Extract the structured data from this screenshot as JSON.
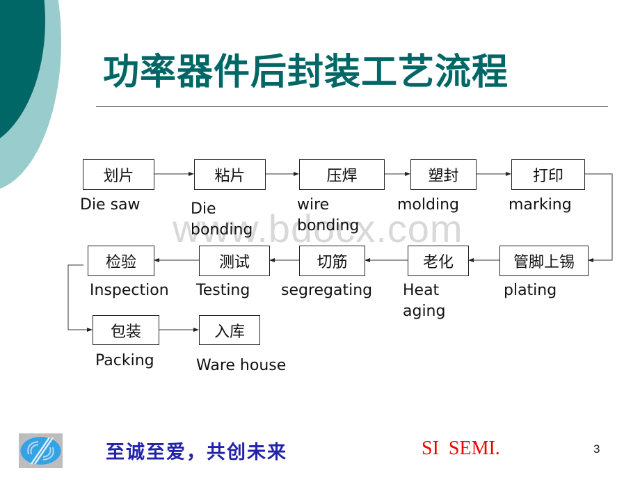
{
  "slide": {
    "title": "功率器件后封装工艺流程",
    "watermark": "www.bdocx.com",
    "page_number": "3"
  },
  "colors": {
    "title": "#006666",
    "deco_dark": "#006666",
    "deco_light": "#99cccc",
    "slogan": "#2222aa",
    "brand": "#ee0000",
    "logo_blue": "#33a3e6"
  },
  "flow": {
    "steps": [
      {
        "zh": "划片",
        "en_lines": [
          "Die saw"
        ]
      },
      {
        "zh": "粘片",
        "en_lines": [
          "Die",
          "bonding"
        ]
      },
      {
        "zh": "压焊",
        "en_lines": [
          "wire",
          "bonding"
        ]
      },
      {
        "zh": "塑封",
        "en_lines": [
          "molding"
        ]
      },
      {
        "zh": "打印",
        "en_lines": [
          "marking"
        ]
      },
      {
        "zh": "管脚上锡",
        "en_lines": [
          "plating"
        ]
      },
      {
        "zh": "老化",
        "en_lines": [
          "Heat",
          "aging"
        ]
      },
      {
        "zh": "切筋",
        "en_lines": [
          "segregating"
        ]
      },
      {
        "zh": "测试",
        "en_lines": [
          "Testing"
        ]
      },
      {
        "zh": "检验",
        "en_lines": [
          "Inspection"
        ]
      },
      {
        "zh": "包装",
        "en_lines": [
          "Packing"
        ]
      },
      {
        "zh": "入库",
        "en_lines": [
          "Ware house"
        ]
      }
    ]
  },
  "footer": {
    "slogan": "至诚至爱，共创未来",
    "brand": "SI  SEMI.",
    "logo_icon": "company-logo-icon"
  }
}
